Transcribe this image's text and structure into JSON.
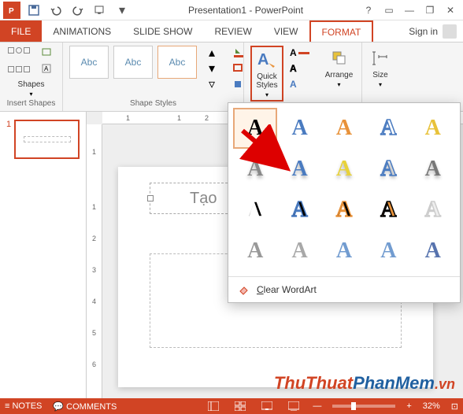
{
  "title": "Presentation1 - PowerPoint",
  "qat": {
    "save": "save-icon",
    "undo": "undo-icon",
    "redo": "redo-icon",
    "start": "start-icon"
  },
  "tabs": {
    "file": "FILE",
    "items": [
      "ANIMATIONS",
      "SLIDE SHOW",
      "REVIEW",
      "VIEW",
      "FORMAT"
    ],
    "active": "FORMAT",
    "signin": "Sign in"
  },
  "ribbon": {
    "insert_shapes": {
      "label": "Insert Shapes",
      "shapes_btn": "Shapes"
    },
    "shape_styles": {
      "label": "Shape Styles",
      "abc": "Abc"
    },
    "wordart_styles": {
      "quick_styles": "Quick Styles"
    },
    "arrange": {
      "label": "Arrange"
    },
    "size": {
      "label": "Size"
    }
  },
  "wordart": {
    "clear_label": "Clear WordArt",
    "styles": [
      {
        "fill": "#000",
        "stroke": "none"
      },
      {
        "fill": "#4a7bc0",
        "stroke": "none"
      },
      {
        "fill": "#e8923a",
        "stroke": "none"
      },
      {
        "fill": "none",
        "stroke": "#4a7bc0"
      },
      {
        "fill": "#e8c23a",
        "stroke": "none"
      },
      {
        "fill": "#888",
        "stroke": "none",
        "shadow": true
      },
      {
        "fill": "#4a7bc0",
        "stroke": "none",
        "shadow": true
      },
      {
        "fill": "#e8d23a",
        "stroke": "none",
        "shadow": true
      },
      {
        "fill": "none",
        "stroke": "#4a7bc0",
        "shadow": true
      },
      {
        "fill": "#777",
        "stroke": "none",
        "shadow": true
      },
      {
        "fill": "#000",
        "stroke": "#fff"
      },
      {
        "fill": "#000",
        "stroke": "#4a7bc0"
      },
      {
        "fill": "#000",
        "stroke": "#e8923a"
      },
      {
        "fill": "#e8923a",
        "stroke": "#000"
      },
      {
        "fill": "#eee",
        "stroke": "#ccc"
      },
      {
        "fill": "#888",
        "stroke": "none",
        "pattern": true
      },
      {
        "fill": "#999",
        "stroke": "none",
        "pattern": true
      },
      {
        "fill": "#5a8bc8",
        "stroke": "none",
        "pattern": true
      },
      {
        "fill": "#5a8bc8",
        "stroke": "none",
        "pattern": true
      },
      {
        "fill": "#3a5ba0",
        "stroke": "none",
        "pattern": true
      }
    ]
  },
  "slide": {
    "number": "1",
    "textbox_content": "Tạo"
  },
  "ruler": {
    "h": [
      "1",
      "",
      "1",
      "2"
    ],
    "v": [
      "1",
      "",
      "1",
      "2",
      "3",
      "4",
      "5",
      "6"
    ]
  },
  "status": {
    "notes": "NOTES",
    "comments": "COMMENTS",
    "zoom": "32%"
  },
  "watermark": {
    "t1": "ThuThuat",
    "t2": "PhanMem",
    "t3": ".vn"
  }
}
